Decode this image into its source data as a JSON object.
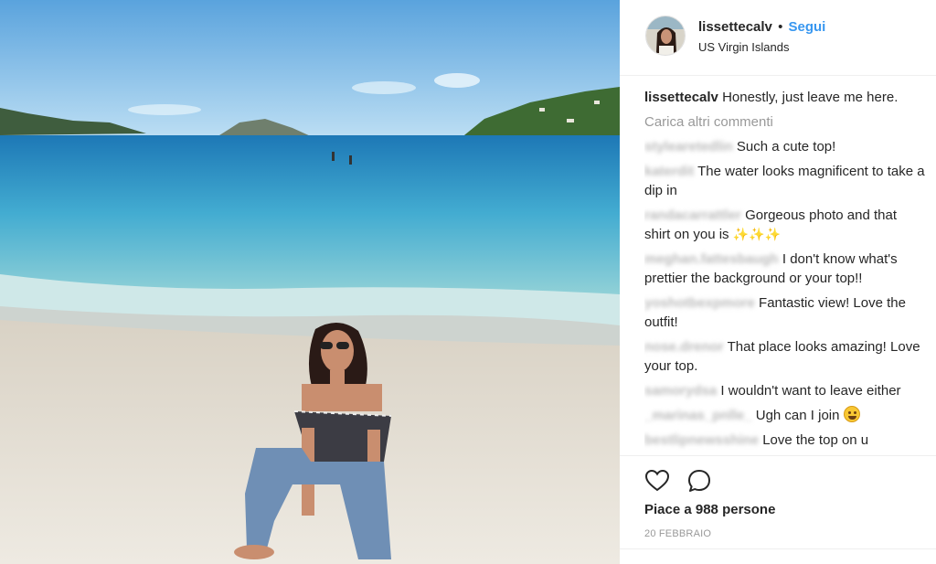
{
  "post": {
    "username": "lissettecalv",
    "separator": "•",
    "follow_label": "Segui",
    "location": "US Virgin Islands",
    "caption_user": "lissettecalv",
    "caption_text": "Honestly, just leave me here.",
    "load_more_label": "Carica altri commenti",
    "comments": [
      {
        "user": "stylearetedlin",
        "text": "Such a cute top!"
      },
      {
        "user": "katerdit",
        "text": "The water looks magnificent to take a dip in"
      },
      {
        "user": "randacarrattler",
        "text": "Gorgeous photo and that shirt on you is",
        "sparkles": "✨✨✨"
      },
      {
        "user": "meghan.fattesbaugh",
        "text": "I don't know what's prettier the background or your top!!"
      },
      {
        "user": "yoshotbexpmore",
        "text": "Fantastic view! Love the outfit!"
      },
      {
        "user": "nose.drenor",
        "text": "That place looks amazing! Love your top."
      },
      {
        "user": "samorydsa",
        "text": "I wouldn't want to leave either"
      },
      {
        "user": "_marinas_pnlle_",
        "text": "Ugh can I join"
      },
      {
        "user": "bestlipnewsshine",
        "text": "Love the top on u"
      }
    ],
    "likes_label": "Piace a 988 persone",
    "date_label": "20 FEBBRAIO",
    "icons": {
      "like": "heart-icon",
      "comment": "comment-bubble-icon"
    },
    "colors": {
      "follow": "#3897f0",
      "muted": "#999999",
      "text": "#262626"
    }
  }
}
